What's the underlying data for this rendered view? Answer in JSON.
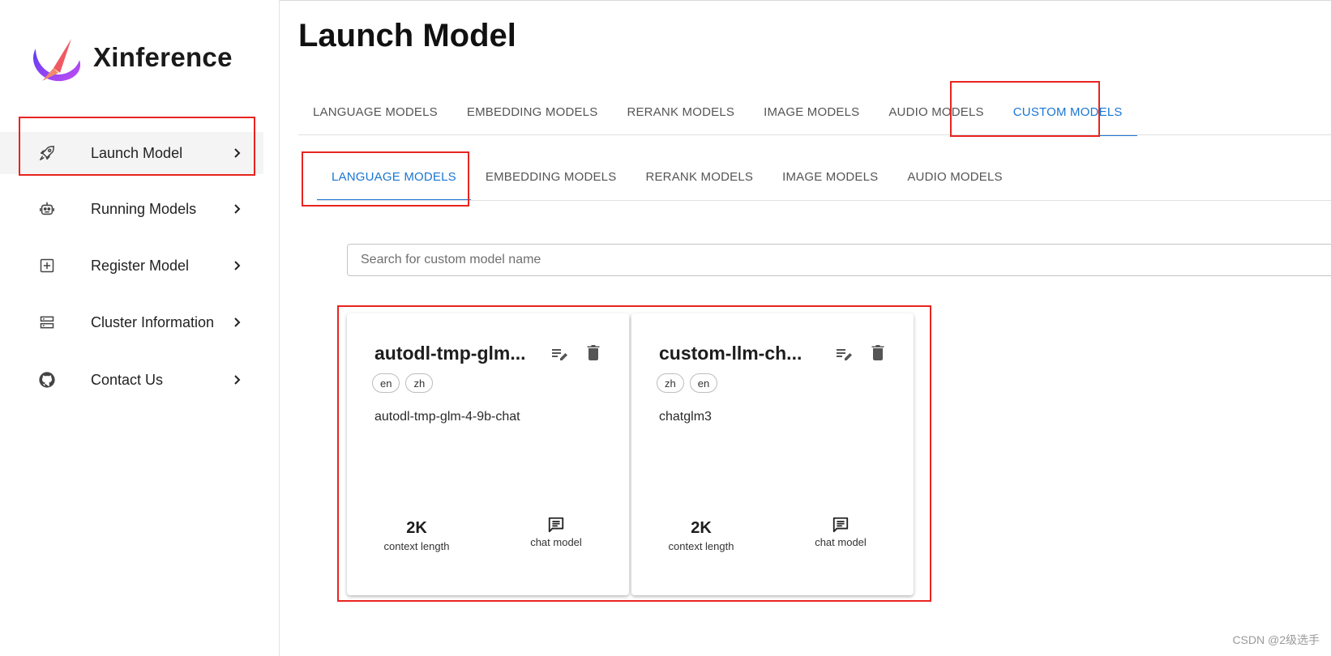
{
  "app": {
    "brand": "Xinference"
  },
  "sidebar": {
    "items": [
      {
        "label": "Launch Model",
        "icon": "rocket-icon"
      },
      {
        "label": "Running Models",
        "icon": "robot-icon"
      },
      {
        "label": "Register Model",
        "icon": "add-box-icon"
      },
      {
        "label": "Cluster Information",
        "icon": "storage-icon"
      },
      {
        "label": "Contact Us",
        "icon": "github-icon"
      }
    ],
    "active_index": 0
  },
  "main": {
    "title": "Launch Model",
    "tabs": [
      "LANGUAGE MODELS",
      "EMBEDDING MODELS",
      "RERANK MODELS",
      "IMAGE MODELS",
      "AUDIO MODELS",
      "CUSTOM MODELS"
    ],
    "active_tab": "CUSTOM MODELS",
    "subtabs": [
      "LANGUAGE MODELS",
      "EMBEDDING MODELS",
      "RERANK MODELS",
      "IMAGE MODELS",
      "AUDIO MODELS"
    ],
    "active_subtab": "LANGUAGE MODELS",
    "search": {
      "placeholder": "Search for custom model name",
      "value": ""
    },
    "cards": [
      {
        "title": "autodl-tmp-glm...",
        "languages": [
          "en",
          "zh"
        ],
        "description": "autodl-tmp-glm-4-9b-chat",
        "context_value": "2K",
        "context_label": "context length",
        "ability_label": "chat model"
      },
      {
        "title": "custom-llm-ch...",
        "languages": [
          "zh",
          "en"
        ],
        "description": "chatglm3",
        "context_value": "2K",
        "context_label": "context length",
        "ability_label": "chat model"
      }
    ]
  },
  "colors": {
    "accent": "#1976d2",
    "highlight": "#e8241f"
  },
  "watermark": "CSDN @2级选手"
}
